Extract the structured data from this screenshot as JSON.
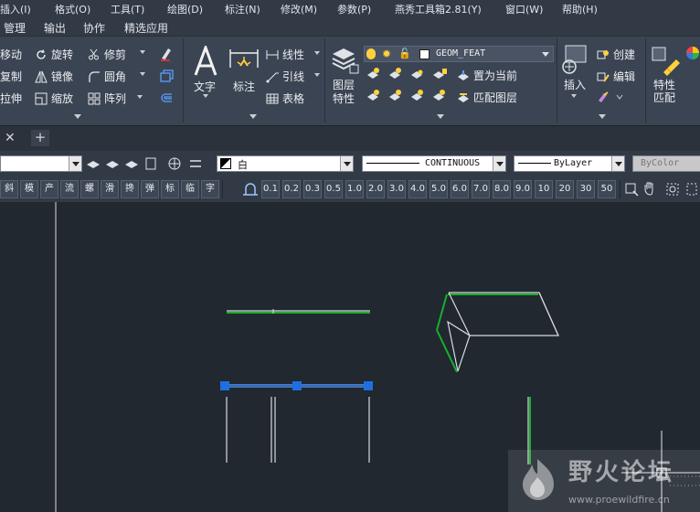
{
  "menu": {
    "items": [
      "插入(I)",
      "格式(O)",
      "工具(T)",
      "绘图(D)",
      "标注(N)",
      "修改(M)",
      "参数(P)",
      "燕秀工具箱2.81(Y)",
      "窗口(W)",
      "帮助(H)"
    ]
  },
  "ribbon_tabs": [
    "管理",
    "输出",
    "协作",
    "精选应用"
  ],
  "modify_panel": {
    "move": "移动",
    "rotate": "旋转",
    "trim": "修剪",
    "copy": "复制",
    "mirror": "镜像",
    "fillet": "圆角",
    "stretch": "拉伸",
    "scale": "缩放",
    "array": "阵列"
  },
  "annotation_panel": {
    "text": "文字",
    "dimension": "标注",
    "linear": "线性",
    "leader": "引线",
    "table": "表格"
  },
  "layers_panel": {
    "layer_props_line1": "图层",
    "layer_props_line2": "特性",
    "current_layer": "GEOM_FEAT",
    "set_current": "置为当前",
    "match_layer": "匹配图层"
  },
  "block_panel": {
    "insert": "插入",
    "create": "创建",
    "edit": "编辑"
  },
  "properties_panel": {
    "line1": "特性",
    "line2": "匹配"
  },
  "props_bar": {
    "color": "白",
    "linetype": "CONTINUOUS",
    "lineweight": "ByLayer",
    "plotstyle": "ByColor"
  },
  "plugin_toolbar": {
    "chars": [
      "斜",
      "模",
      "产",
      "流",
      "螺",
      "滑",
      "搀",
      "弹",
      "标",
      "临",
      "字"
    ],
    "scales": [
      "0.1",
      "0.2",
      "0.3",
      "0.5",
      "1.0",
      "2.0",
      "3.0",
      "4.0",
      "5.0",
      "6.0",
      "7.0",
      "8.0",
      "9.0",
      "10",
      "20",
      "30",
      "50"
    ]
  },
  "watermark": {
    "text": "野火论坛",
    "url": "www.proewildfire.cn"
  },
  "colors": {
    "bg": "#212830",
    "ribbon": "#3b4453",
    "green": "#17b02b",
    "selected": "#1e6fe0",
    "line": "#d8dbe0"
  }
}
